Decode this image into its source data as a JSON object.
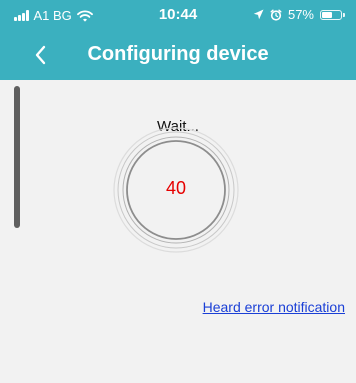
{
  "status_bar": {
    "carrier": "A1 BG",
    "time": "10:44",
    "battery_text": "57%",
    "battery_level": 0.57
  },
  "nav": {
    "title": "Configuring device",
    "back_icon": "chevron-left-icon"
  },
  "main": {
    "wait_label": "Wait...",
    "countdown": "40",
    "error_link": "Heard error notification"
  },
  "colors": {
    "header": "#3bb0bf",
    "background": "#f2f2f2",
    "countdown": "#e60000",
    "link": "#1a3fd6"
  }
}
